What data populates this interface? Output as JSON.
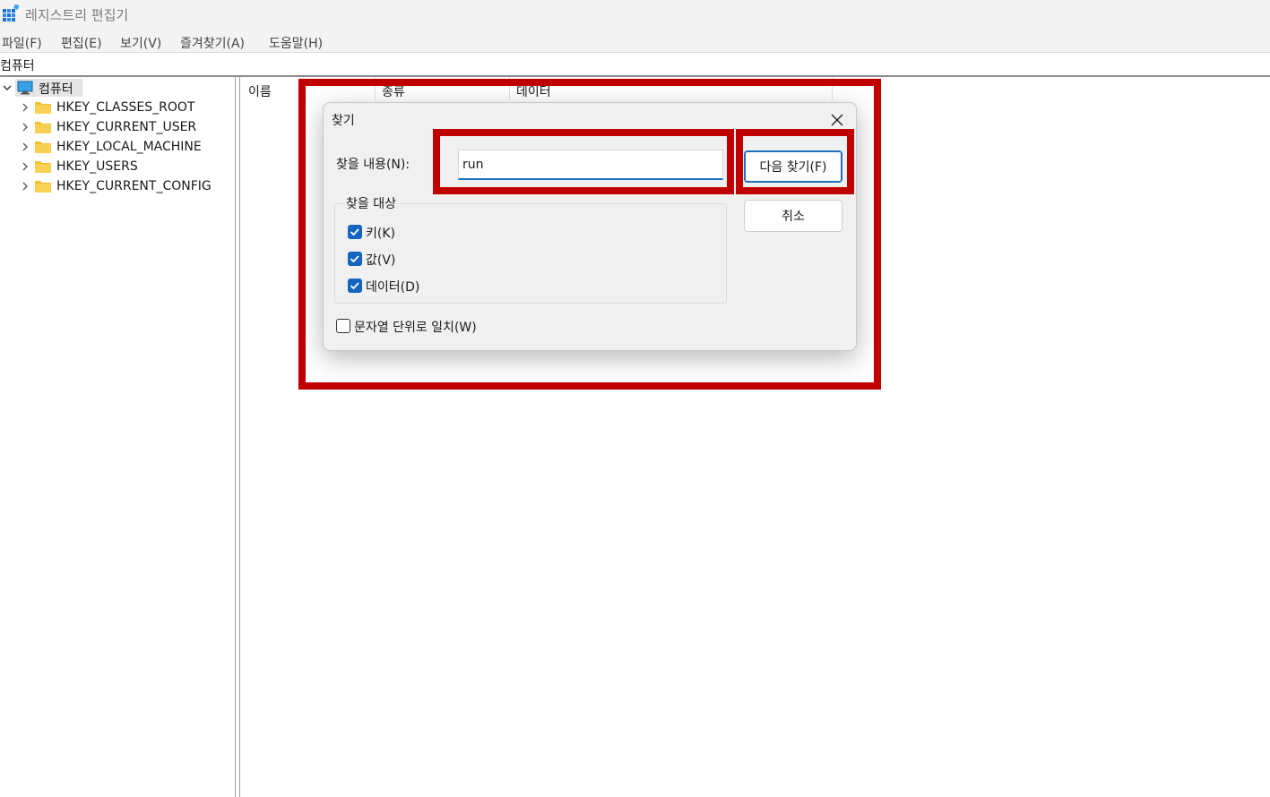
{
  "window": {
    "title": "레지스트리 편집기"
  },
  "menu": [
    "파일(F)",
    "편집(E)",
    "보기(V)",
    "즐겨찾기(A)",
    "도움말(H)"
  ],
  "address": "컴퓨터",
  "tree": {
    "root": "컴퓨터",
    "children": [
      "HKEY_CLASSES_ROOT",
      "HKEY_CURRENT_USER",
      "HKEY_LOCAL_MACHINE",
      "HKEY_USERS",
      "HKEY_CURRENT_CONFIG"
    ]
  },
  "list": {
    "columns": [
      "이름",
      "종류",
      "데이터"
    ]
  },
  "dialog": {
    "title": "찾기",
    "find_label": "찾을 내용(N):",
    "find_value": "run",
    "find_next": "다음 찾기(F)",
    "cancel": "취소",
    "group_title": "찾을 대상",
    "options": [
      {
        "label": "키(K)",
        "checked": true
      },
      {
        "label": "값(V)",
        "checked": true
      },
      {
        "label": "데이터(D)",
        "checked": true
      }
    ],
    "match_whole": {
      "label": "문자열 단위로 일치(W)",
      "checked": false
    }
  },
  "colors": {
    "highlight": "#c00000",
    "accent": "#1565c0"
  }
}
